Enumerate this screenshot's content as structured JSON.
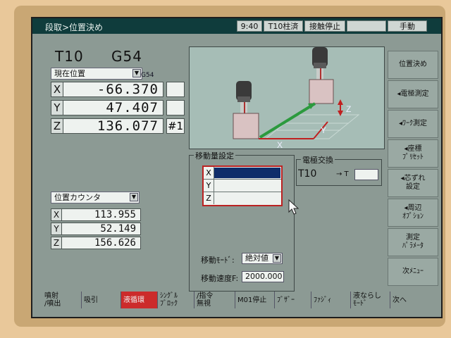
{
  "header": {
    "breadcrumb": "段取>位置決め",
    "time": "9:40",
    "status1": "T10柱済",
    "status2": "接触停止",
    "blank": "",
    "mode": "手動"
  },
  "left": {
    "tool": "T10",
    "wcs": "G54",
    "coord_select": "現在位置",
    "coord_tag": "G54",
    "axes": [
      {
        "label": "X",
        "value": "-66.370"
      },
      {
        "label": "Y",
        "value": "47.407"
      },
      {
        "label": "Z",
        "value": "136.077"
      }
    ],
    "side_cells": [
      "",
      "",
      "#1"
    ],
    "counter_select": "位置カウンタ",
    "counter": [
      {
        "label": "X",
        "value": "113.955"
      },
      {
        "label": "Y",
        "value": "52.149"
      },
      {
        "label": "Z",
        "value": "156.626"
      }
    ]
  },
  "view3d": {
    "x_label": "X",
    "y_label": "Y",
    "z_label": "Z"
  },
  "move": {
    "title": "移動量設定",
    "rows": [
      {
        "label": "X",
        "value": ""
      },
      {
        "label": "Y",
        "value": ""
      },
      {
        "label": "Z",
        "value": ""
      }
    ],
    "mode_label": "移動ﾓｰﾄﾞ:",
    "mode_value": "絶対値",
    "speed_label": "移動速度F:",
    "speed_value": "2000.000"
  },
  "electrode": {
    "title": "電極交換",
    "current": "T10",
    "arrow": "→ T",
    "target": ""
  },
  "softkeys": [
    {
      "label": "位置決め"
    },
    {
      "label": "◂電極測定"
    },
    {
      "label": "◂ﾜｰｸ測定"
    },
    {
      "label": "◂座標\nﾌﾟﾘｾｯﾄ"
    },
    {
      "label": "◂芯ずれ\n設定"
    },
    {
      "label": "◂周辺\nｵﾌﾟｼｮﾝ"
    },
    {
      "label": "測定\nﾊﾟﾗﾒｰﾀ"
    },
    {
      "label": "次ﾒﾆｭｰ"
    }
  ],
  "bottom_keys": [
    {
      "label": "噴射\n/噴出",
      "active": false
    },
    {
      "label": "吸引",
      "active": false
    },
    {
      "label": "液循環",
      "active": true
    },
    {
      "label": "ｼﾝｸﾞﾙ\nﾌﾞﾛｯｸ",
      "active": false
    },
    {
      "label": "/指令\n無視",
      "active": false
    },
    {
      "label": "M01停止",
      "active": false
    },
    {
      "label": "ﾌﾞｻﾞｰ",
      "active": false
    },
    {
      "label": "ﾌｧｼﾞｨ",
      "active": false
    },
    {
      "label": "液ならし\nﾓｰﾄﾞ",
      "active": false
    },
    {
      "label": "次へ",
      "active": false
    }
  ],
  "colors": {
    "titlebar": "#0f3c3c",
    "active_key": "#cc2b2b",
    "selection": "#0f2d6a"
  }
}
